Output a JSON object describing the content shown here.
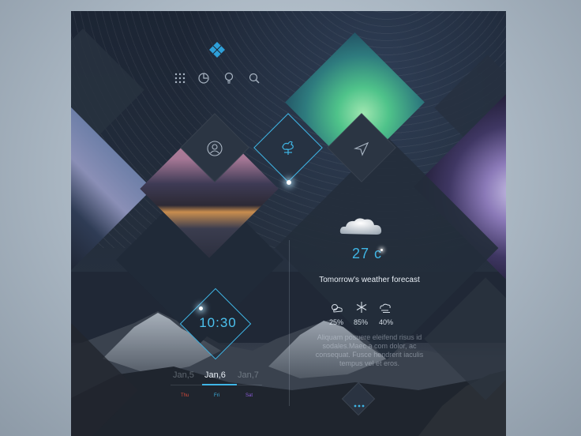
{
  "top_icons": [
    {
      "name": "apps-grid-icon"
    },
    {
      "name": "clock-chart-icon"
    },
    {
      "name": "lightbulb-icon"
    },
    {
      "name": "search-icon"
    }
  ],
  "nav": [
    {
      "name": "profile-icon"
    },
    {
      "name": "weathervane-icon"
    },
    {
      "name": "send-icon"
    }
  ],
  "weather": {
    "temperature": "27 c",
    "forecast_title": "Tomorrow's weather forecast",
    "stats": [
      "25%",
      "85%",
      "40%"
    ],
    "description": "Aliquam posuere eleifend risus id sodales.Maec a com dolor, ac consequat. Fusce hendrerit iaculis tempus vel et eros."
  },
  "clock": {
    "time": "10:30",
    "dates": [
      "Jan,5",
      "Jan,6",
      "Jan,7"
    ],
    "days": [
      "Thu",
      "Fri",
      "Sat"
    ]
  },
  "colors": {
    "accent": "#3fb6e6",
    "logo": "#2e9fd8",
    "thu": "#d34a3a",
    "fri": "#3fb6e6",
    "sat": "#8a5cd6"
  }
}
